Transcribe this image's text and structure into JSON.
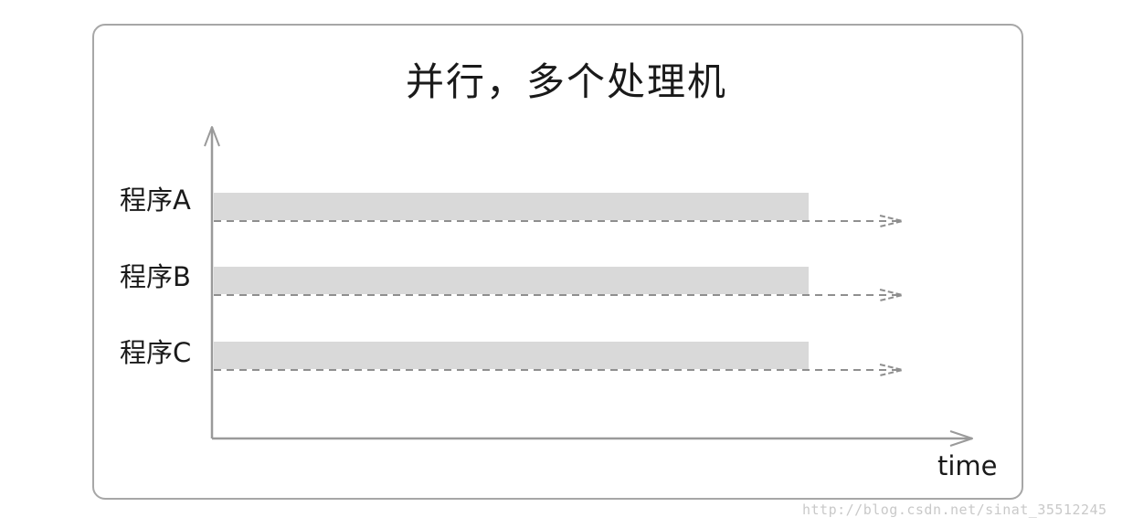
{
  "title": "并行，多个处理机",
  "axis": {
    "x_label": "time"
  },
  "programs": [
    {
      "label": "程序A"
    },
    {
      "label": "程序B"
    },
    {
      "label": "程序C"
    }
  ],
  "watermark": "http://blog.csdn.net/sinat_35512245",
  "colors": {
    "bar": "#d9d9d9",
    "axis": "#9a9a9a",
    "dashed": "#8f8f8f",
    "frame": "#a7a7a7"
  }
}
